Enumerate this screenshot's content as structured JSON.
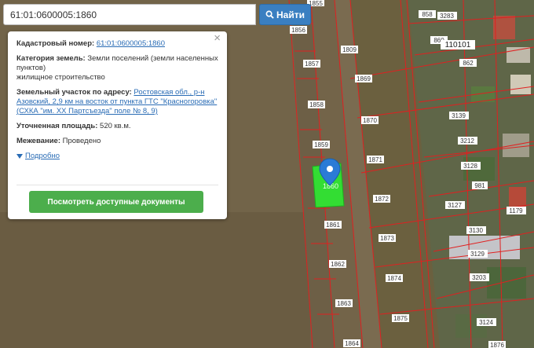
{
  "search": {
    "value": "61:01:0600005:1860",
    "button_label": "Найти"
  },
  "popup": {
    "cadastral_label": "Кадастровый номер:",
    "cadastral_value": "61:01:0600005:1860",
    "category_label": "Категория земель:",
    "category_value": "Земли поселений (земли населенных пунктов)",
    "category_use": "жилищное строительство",
    "address_label": "Земельный участок по адресу:",
    "address_value": "Ростовская обл., р-н Азовский, 2,9 км на восток от пункта ГТС \"Красногоровка\" (СХКА \"им. XX Партсъезда\" поле № 8, 9)",
    "area_label": "Уточненная площадь:",
    "area_value": "520 кв.м.",
    "survey_label": "Межевание:",
    "survey_value": "Проведено",
    "more_label": "Подробно",
    "close_glyph": "×",
    "docs_button_label": "Посмотреть доступные документы"
  },
  "map": {
    "block_label": "110101",
    "highlight_label": "1860",
    "parcels": [
      "1855",
      "1856",
      "1857",
      "1858",
      "1859",
      "1861",
      "1862",
      "1863",
      "1864",
      "1809",
      "1869",
      "1870",
      "1871",
      "1872",
      "1873",
      "1874",
      "1875",
      "858",
      "3283",
      "860",
      "862",
      "3139",
      "3212",
      "3128",
      "981",
      "3127",
      "1179",
      "3130",
      "3129",
      "3203",
      "3124",
      "1876"
    ],
    "colors": {
      "highlight": "#33dd33",
      "boundary": "#e02020",
      "marker": "#2b7bd6"
    }
  }
}
